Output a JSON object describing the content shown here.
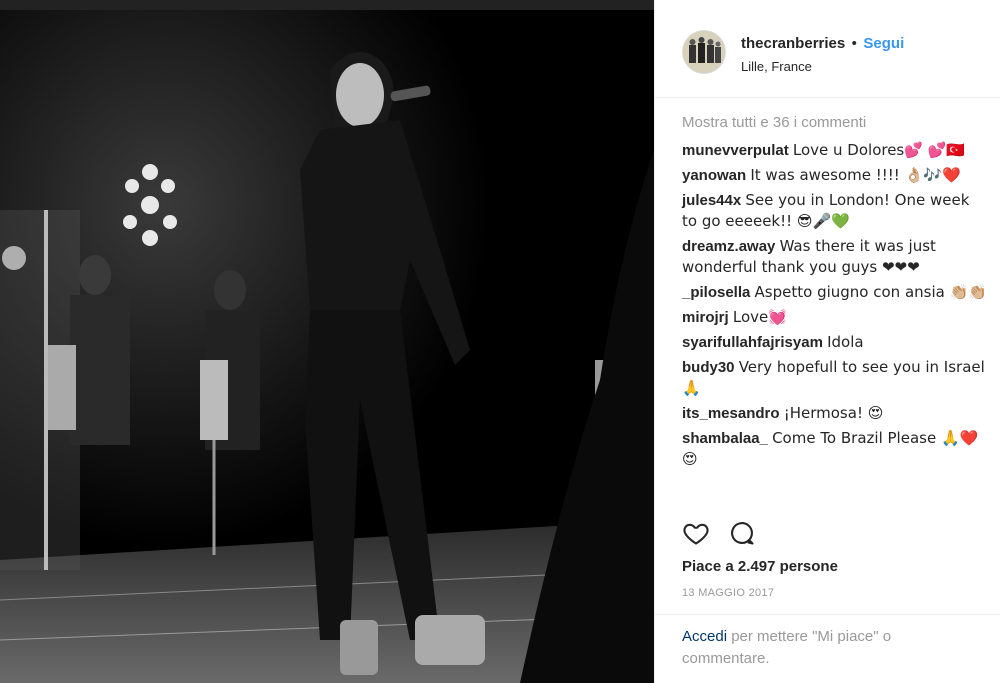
{
  "post": {
    "username": "thecranberries",
    "separator": "•",
    "follow_label": "Segui",
    "location": "Lille, France"
  },
  "comments": {
    "show_all": "Mostra tutti e 36 i commenti",
    "items": [
      {
        "user": "munevverpulat",
        "text": "Love u Dolores💕 💕🇹🇷"
      },
      {
        "user": "yanowan",
        "text": "It was awesome !!!! 👌🏼🎶❤️"
      },
      {
        "user": "jules44x",
        "text": "See you in London! One week to go eeeeek!! 😎🎤💚"
      },
      {
        "user": "dreamz.away",
        "text": "Was there it was just wonderful thank you guys ❤❤❤"
      },
      {
        "user": "_pilosella",
        "text": "Aspetto giugno con ansia 👏🏼👏🏼"
      },
      {
        "user": "mirojrj",
        "text": "Love💓"
      },
      {
        "user": "syarifullahfajrisyam",
        "text": "Idola"
      },
      {
        "user": "budy30",
        "text": "Very hopefull to see you in Israel 🙏"
      },
      {
        "user": "its_mesandro",
        "text": "¡Hermosa! 😍"
      },
      {
        "user": "shambalaa_",
        "text": "Come To Brazil Please 🙏❤️😍"
      }
    ]
  },
  "actions": {
    "like_icon": "heart-icon",
    "comment_icon": "speech-bubble-icon",
    "likes_text": "Piace a 2.497 persone",
    "date": "13 MAGGIO 2017"
  },
  "login": {
    "link": "Accedi",
    "text": "per mettere \"Mi piace\" o commentare."
  }
}
